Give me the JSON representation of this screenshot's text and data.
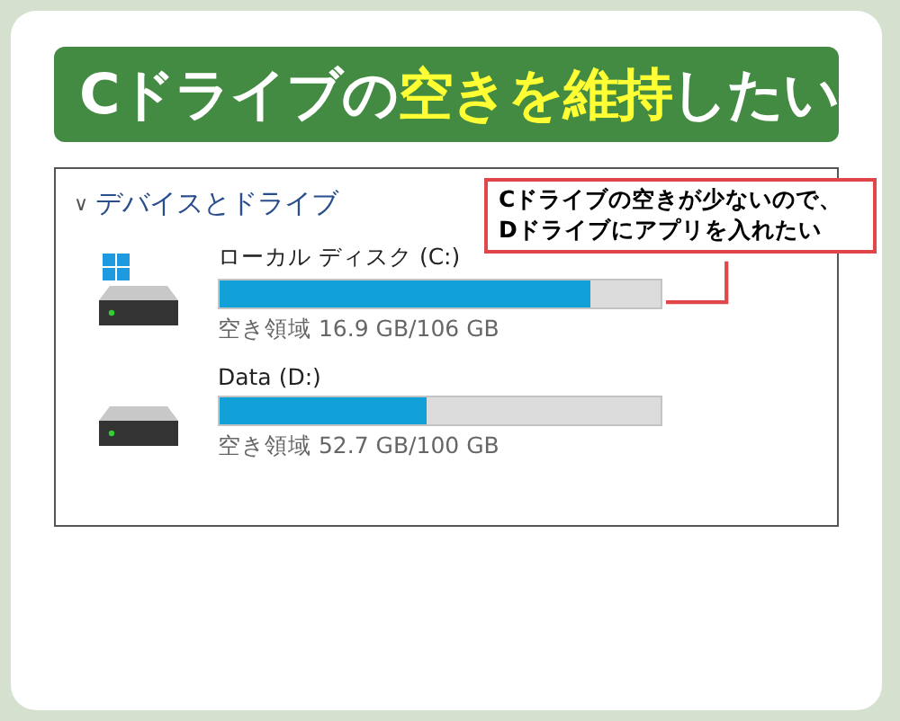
{
  "title": {
    "parts": [
      {
        "text": "Cドライブの",
        "highlighted": false
      },
      {
        "text": "空きを維持",
        "highlighted": true
      },
      {
        "text": "したい",
        "highlighted": false
      }
    ]
  },
  "section": {
    "chevron": "∨",
    "label": "デバイスとドライブ",
    "expanded": true
  },
  "drives": [
    {
      "name": "ローカル ディスク (C:)",
      "kind": "system",
      "level": 0.84,
      "free_space": "空き領域 16.9 GB/106 GB"
    },
    {
      "name": "Data (D:)",
      "kind": "data",
      "level": 0.47,
      "free_space": "空き領域 52.7 GB/100 GB"
    }
  ],
  "callout": {
    "lines": [
      "Cドライブの空きが少ないので、",
      "Dドライブにアプリを入れたい"
    ]
  }
}
